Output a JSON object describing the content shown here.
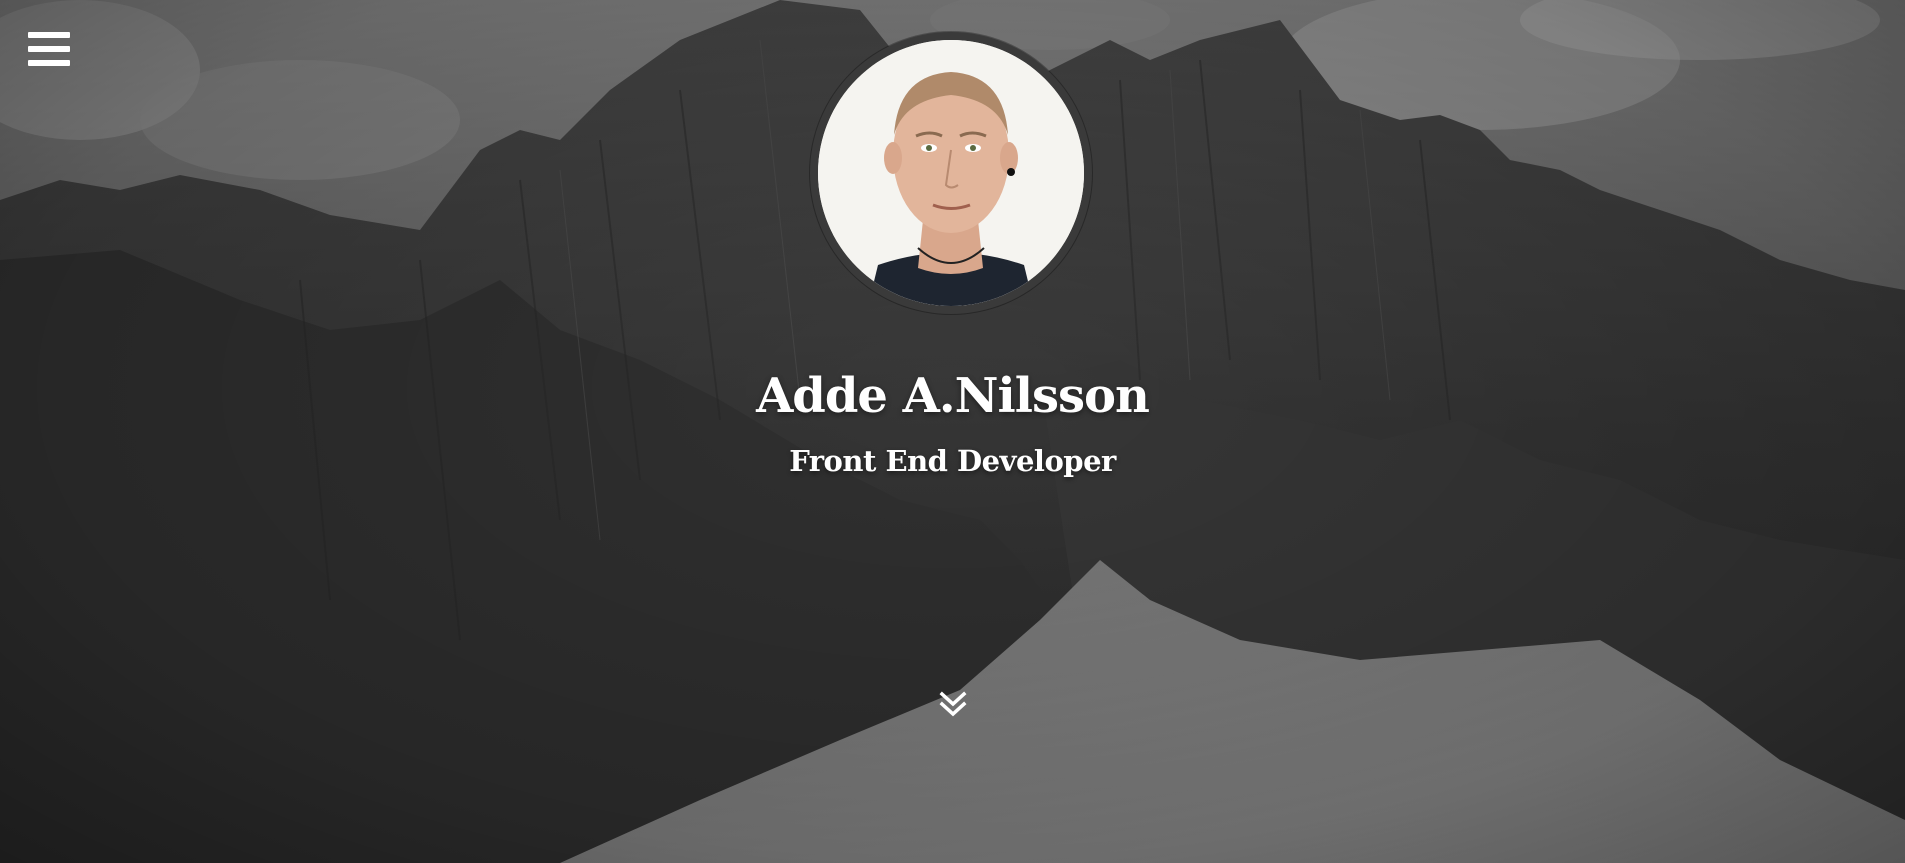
{
  "menu": {
    "icon": "hamburger-menu-icon"
  },
  "profile": {
    "photo_icon": "profile-photo",
    "name": "Adde A.Nilsson",
    "title": "Front End Developer"
  },
  "scroll": {
    "icon": "double-chevron-down-icon"
  },
  "colors": {
    "text": "#ffffff",
    "avatar_ring": "#3a3a3a"
  }
}
